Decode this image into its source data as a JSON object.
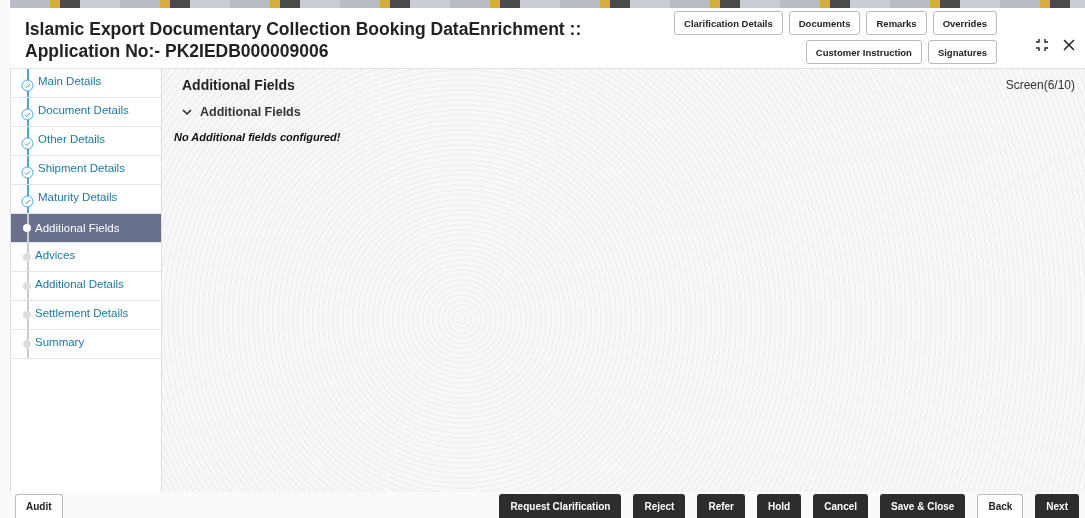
{
  "header": {
    "title": "Islamic Export Documentary Collection Booking DataEnrichment ::",
    "subtitle": "Application No:- PK2IEDB000009006",
    "buttons_row_1": [
      "Clarification Details",
      "Documents",
      "Remarks",
      "Overrides"
    ],
    "buttons_row_2": [
      "Customer Instruction",
      "Signatures"
    ]
  },
  "steps": [
    {
      "label": "Main Details",
      "completed": true,
      "selected": false
    },
    {
      "label": "Document Details",
      "completed": true,
      "selected": false
    },
    {
      "label": "Other Details",
      "completed": true,
      "selected": false
    },
    {
      "label": "Shipment Details",
      "completed": true,
      "selected": false
    },
    {
      "label": "Maturity Details",
      "completed": true,
      "selected": false
    },
    {
      "label": "Additional Fields",
      "completed": false,
      "selected": true
    },
    {
      "label": "Advices",
      "completed": false,
      "selected": false
    },
    {
      "label": "Additional Details",
      "completed": false,
      "selected": false
    },
    {
      "label": "Settlement Details",
      "completed": false,
      "selected": false
    },
    {
      "label": "Summary",
      "completed": false,
      "selected": false
    }
  ],
  "content": {
    "title": "Additional Fields",
    "screen": "Screen(6/10)",
    "section": {
      "title": "Additional Fields",
      "expanded": true,
      "message": "No Additional fields configured!"
    }
  },
  "footer": {
    "left": [
      {
        "label": "Audit",
        "kind": "secondary"
      }
    ],
    "right": [
      {
        "label": "Request Clarification",
        "kind": "primary"
      },
      {
        "label": "Reject",
        "kind": "primary"
      },
      {
        "label": "Refer",
        "kind": "primary"
      },
      {
        "label": "Hold",
        "kind": "primary"
      },
      {
        "label": "Cancel",
        "kind": "primary"
      },
      {
        "label": "Save & Close",
        "kind": "primary"
      },
      {
        "label": "Back",
        "kind": "secondary"
      },
      {
        "label": "Next",
        "kind": "primary"
      }
    ]
  }
}
